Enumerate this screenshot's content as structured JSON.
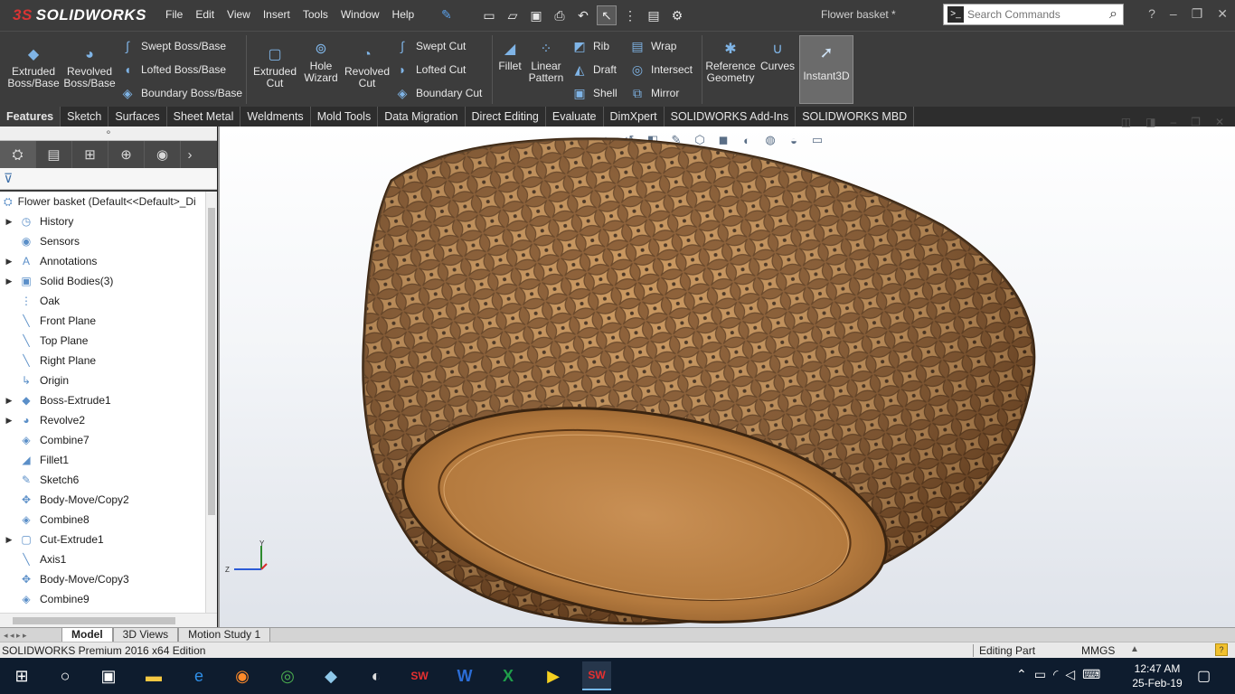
{
  "app": {
    "brand_ds": "3S",
    "brand_name": "SOLIDWORKS",
    "doc_title": "Flower basket *"
  },
  "menu": [
    "File",
    "Edit",
    "View",
    "Insert",
    "Tools",
    "Window",
    "Help"
  ],
  "search": {
    "placeholder": "Search Commands"
  },
  "command_manager": {
    "extruded_boss": "Extruded\nBoss/Base",
    "revolved_boss": "Revolved\nBoss/Base",
    "swept_boss": "Swept Boss/Base",
    "lofted_boss": "Lofted Boss/Base",
    "boundary_boss": "Boundary Boss/Base",
    "extruded_cut": "Extruded\nCut",
    "hole_wizard": "Hole\nWizard",
    "revolved_cut": "Revolved\nCut",
    "swept_cut": "Swept Cut",
    "lofted_cut": "Lofted Cut",
    "boundary_cut": "Boundary Cut",
    "fillet": "Fillet",
    "linear_pattern": "Linear\nPattern",
    "rib": "Rib",
    "draft": "Draft",
    "shell": "Shell",
    "wrap": "Wrap",
    "intersect": "Intersect",
    "mirror": "Mirror",
    "reference_geometry": "Reference\nGeometry",
    "curves": "Curves",
    "instant3d": "Instant3D"
  },
  "tabs": [
    "Features",
    "Sketch",
    "Surfaces",
    "Sheet Metal",
    "Weldments",
    "Mold Tools",
    "Data Migration",
    "Direct Editing",
    "Evaluate",
    "DimXpert",
    "SOLIDWORKS Add-Ins",
    "SOLIDWORKS MBD"
  ],
  "tree": {
    "root": "Flower basket  (Default<<Default>_Di",
    "items": [
      {
        "label": "History",
        "icon": "history-icon",
        "expandable": true
      },
      {
        "label": "Sensors",
        "icon": "sensor-icon",
        "expandable": false
      },
      {
        "label": "Annotations",
        "icon": "annotation-icon",
        "expandable": true
      },
      {
        "label": "Solid Bodies(3)",
        "icon": "solid-bodies-icon",
        "expandable": true
      },
      {
        "label": "Oak",
        "icon": "material-icon",
        "expandable": false
      },
      {
        "label": "Front Plane",
        "icon": "plane-icon",
        "expandable": false
      },
      {
        "label": "Top Plane",
        "icon": "plane-icon",
        "expandable": false
      },
      {
        "label": "Right Plane",
        "icon": "plane-icon",
        "expandable": false
      },
      {
        "label": "Origin",
        "icon": "origin-icon",
        "expandable": false
      },
      {
        "label": "Boss-Extrude1",
        "icon": "extrude-icon",
        "expandable": true
      },
      {
        "label": "Revolve2",
        "icon": "revolve-icon",
        "expandable": true
      },
      {
        "label": "Combine7",
        "icon": "combine-icon",
        "expandable": false
      },
      {
        "label": "Fillet1",
        "icon": "fillet-icon",
        "expandable": false
      },
      {
        "label": "Sketch6",
        "icon": "sketch-icon",
        "expandable": false
      },
      {
        "label": "Body-Move/Copy2",
        "icon": "move-copy-icon",
        "expandable": false
      },
      {
        "label": "Combine8",
        "icon": "combine-icon",
        "expandable": false
      },
      {
        "label": "Cut-Extrude1",
        "icon": "cut-extrude-icon",
        "expandable": true
      },
      {
        "label": "Axis1",
        "icon": "axis-icon",
        "expandable": false
      },
      {
        "label": "Body-Move/Copy3",
        "icon": "move-copy-icon",
        "expandable": false
      },
      {
        "label": "Combine9",
        "icon": "combine-icon",
        "expandable": false
      }
    ]
  },
  "bottom_tabs": [
    "Model",
    "3D Views",
    "Motion Study 1"
  ],
  "status": {
    "left": "SOLIDWORKS Premium 2016 x64 Edition",
    "mode": "Editing Part",
    "units": "MMGS"
  },
  "taskbar": {
    "time": "12:47 AM",
    "date": "25-Feb-19"
  },
  "colors": {
    "wood_light": "#b8834a",
    "wood_dark": "#6f4420",
    "accent": "#d83434"
  }
}
